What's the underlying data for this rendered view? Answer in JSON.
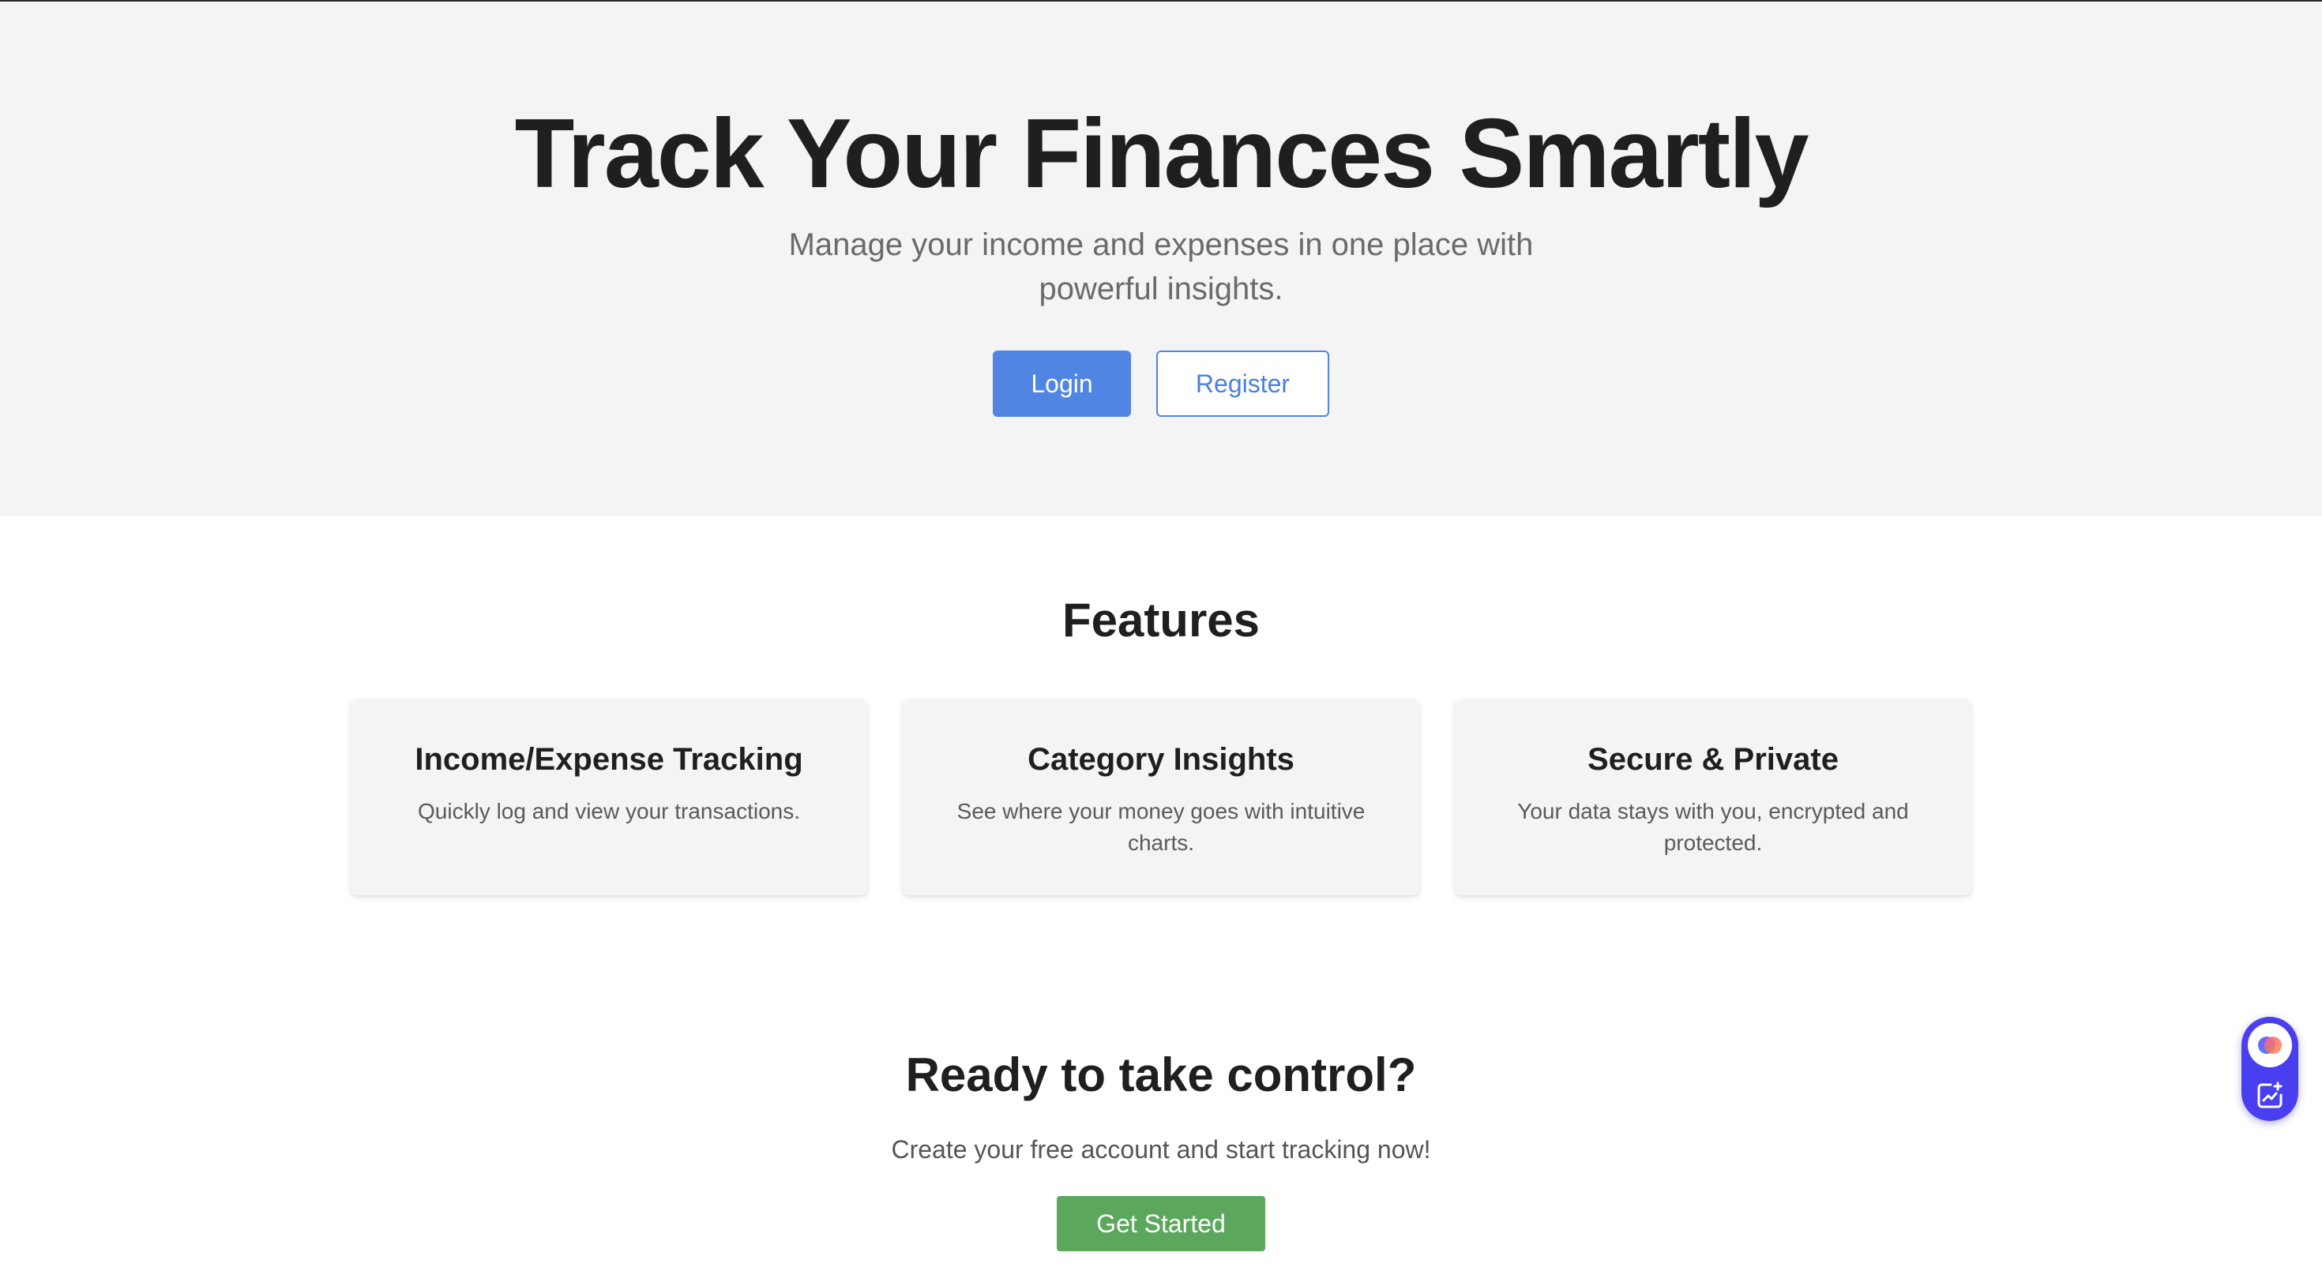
{
  "hero": {
    "title": "Track Your Finances Smartly",
    "subtitle": "Manage your income and expenses in one place with powerful insights.",
    "login_label": "Login",
    "register_label": "Register"
  },
  "features": {
    "title": "Features",
    "cards": [
      {
        "title": "Income/Expense Tracking",
        "description": "Quickly log and view your transactions."
      },
      {
        "title": "Category Insights",
        "description": "See where your money goes with intuitive charts."
      },
      {
        "title": "Secure & Private",
        "description": "Your data stays with you, encrypted and protected."
      }
    ]
  },
  "cta": {
    "title": "Ready to take control?",
    "subtitle": "Create your free account and start tracking now!",
    "button_label": "Get Started"
  },
  "widget": {
    "top_icon": "assistant-orb-icon",
    "bottom_icon": "chart-sparkle-icon"
  },
  "colors": {
    "hero_bg": "#f4f4f4",
    "primary": "#5185e3",
    "cta_green": "#5ba85c",
    "widget": "#4a3ff0"
  }
}
